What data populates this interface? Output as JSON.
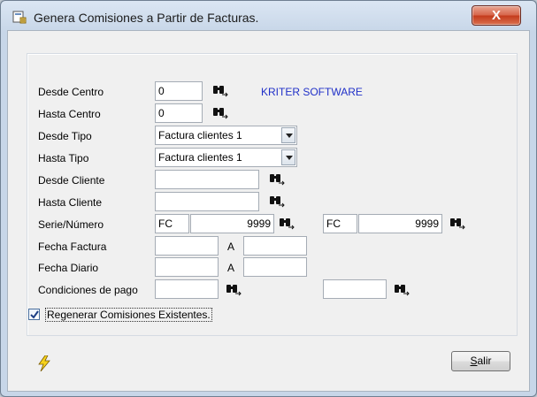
{
  "window": {
    "title": "Genera Comisiones a Partir de Facturas.",
    "close_label": "X"
  },
  "brand": "KRITER SOFTWARE",
  "labels": {
    "desde_centro": "Desde Centro",
    "hasta_centro": "Hasta Centro",
    "desde_tipo": "Desde Tipo",
    "hasta_tipo": "Hasta Tipo",
    "desde_cliente": "Desde Cliente",
    "hasta_cliente": "Hasta Cliente",
    "serie_numero": "Serie/Número",
    "fecha_factura": "Fecha Factura",
    "fecha_diario": "Fecha Diario",
    "condiciones_pago": "Condiciones de pago",
    "a_factura": "A",
    "a_diario": "A"
  },
  "fields": {
    "desde_centro": "0",
    "hasta_centro": "0",
    "desde_tipo": "Factura clientes 1",
    "hasta_tipo": "Factura clientes 1",
    "desde_cliente": "",
    "hasta_cliente": "",
    "serie_desde": "FC",
    "numero_desde": "9999",
    "serie_hasta": "FC",
    "numero_hasta": "9999",
    "fecha_factura_desde": "",
    "fecha_factura_hasta": "",
    "fecha_diario_desde": "",
    "fecha_diario_hasta": "",
    "condiciones_desde": "",
    "condiciones_hasta": ""
  },
  "checkbox": {
    "label": "Regenerar Comisiones Existentes.",
    "checked": true
  },
  "buttons": {
    "salir_first": "S",
    "salir_rest": "alir"
  },
  "icons": {
    "lookup": "binoculars-icon",
    "run": "lightning-icon",
    "app": "window-app-icon"
  }
}
